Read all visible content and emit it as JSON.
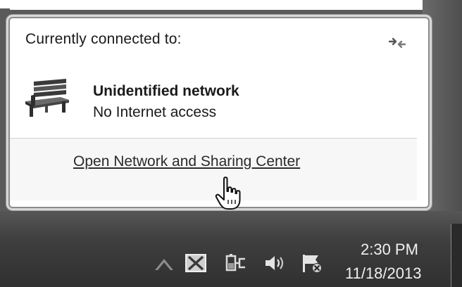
{
  "popup": {
    "connected_label": "Currently connected to:",
    "network_name": "Unidentified network",
    "network_status": "No Internet access",
    "link_label": "Open Network and Sharing Center"
  },
  "tray": {
    "time": "2:30 PM",
    "date": "11/18/2013",
    "icons": [
      "show-hidden-icons-icon",
      "network-x-icon",
      "power-icon",
      "speaker-icon",
      "action-center-flag-icon"
    ]
  },
  "colors": {
    "popup_bg": "#ffffff",
    "taskbar_bg": "#3e3e3e",
    "text": "#1a1a1a"
  }
}
